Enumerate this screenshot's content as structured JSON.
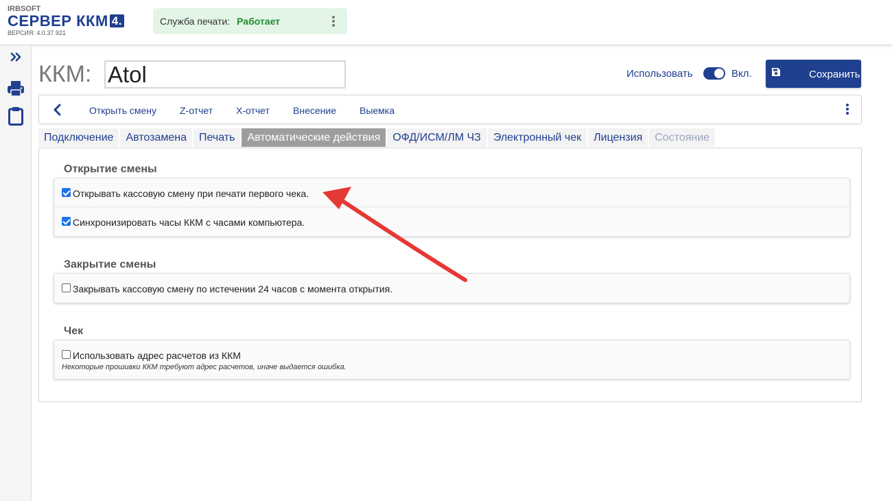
{
  "header": {
    "brand": "IRBSOFT",
    "product": "СЕРВЕР ККМ",
    "product_version_badge": "4.",
    "version": "ВЕРСИЯ: 4.0.37.921",
    "service_label": "Служба печати:",
    "service_status": "Работает",
    "service_status_color": "#1f8a2b"
  },
  "sidebar": {
    "items": [
      {
        "icon": "double-chevron-right-icon"
      },
      {
        "icon": "printer-icon"
      },
      {
        "icon": "clipboard-icon"
      }
    ]
  },
  "title": {
    "label": "ККМ:",
    "device_name": "Atol",
    "use_label": "Использовать",
    "toggle_on": true,
    "on_label": "Вкл.",
    "save_label": "Сохранить"
  },
  "toolbar": {
    "items": [
      "Открыть смену",
      "Z-отчет",
      "X-отчет",
      "Внесение",
      "Выемка"
    ]
  },
  "tabs": {
    "items": [
      "Подключение",
      "Автозамена",
      "Печать",
      "Автоматические действия",
      "ОФД/ИСМ/ЛМ ЧЗ",
      "Электронный чек",
      "Лицензия",
      "Состояние"
    ],
    "active": "Автоматические действия",
    "disabled": "Состояние"
  },
  "sections": {
    "open_shift": {
      "title": "Открытие смены",
      "options": [
        {
          "label": "Открывать кассовую смену при печати первого чека.",
          "checked": true
        },
        {
          "label": "Синхронизировать часы ККМ с часами компьютера.",
          "checked": true
        }
      ]
    },
    "close_shift": {
      "title": "Закрытие смены",
      "options": [
        {
          "label": "Закрывать кассовую смену по истечении 24 часов с момента открытия.",
          "checked": false
        }
      ]
    },
    "receipt": {
      "title": "Чек",
      "options": [
        {
          "label": "Использовать адрес расчетов из ККМ",
          "checked": false,
          "hint": "Некоторые прошивки ККМ требуют адрес расчетов, иначе выдается ошибка."
        }
      ]
    }
  },
  "colors": {
    "accent": "#1f3f8f",
    "annotation_arrow": "#e53935"
  }
}
